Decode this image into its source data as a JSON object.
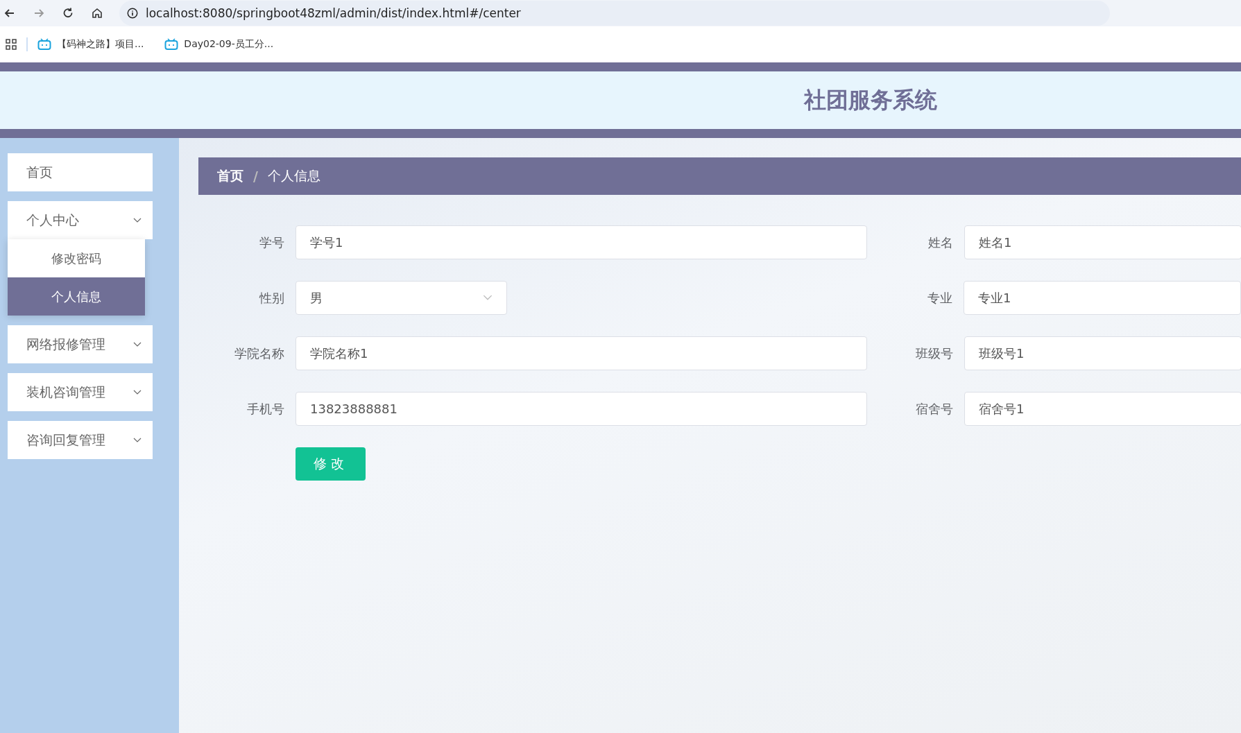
{
  "browser": {
    "url": "localhost:8080/springboot48zml/admin/dist/index.html#/center",
    "bookmarks": [
      "【码神之路】项目...",
      "Day02-09-员工分..."
    ]
  },
  "header": {
    "title": "社团服务系统"
  },
  "sidebar": {
    "items": [
      {
        "label": "首页",
        "kind": "link"
      },
      {
        "label": "个人中心",
        "kind": "submenu",
        "expanded": true,
        "children": [
          {
            "label": "修改密码",
            "selected": false
          },
          {
            "label": "个人信息",
            "selected": true
          }
        ]
      },
      {
        "label": "网络报修管理",
        "kind": "submenu"
      },
      {
        "label": "装机咨询管理",
        "kind": "submenu"
      },
      {
        "label": "咨询回复管理",
        "kind": "submenu"
      }
    ]
  },
  "breadcrumb": {
    "items": [
      "首页",
      "个人信息"
    ],
    "separator": "/"
  },
  "form": {
    "rows": [
      [
        {
          "label": "学号",
          "value": "学号1",
          "kind": "input"
        },
        {
          "label": "姓名",
          "value": "姓名1",
          "kind": "input"
        }
      ],
      [
        {
          "label": "性别",
          "value": "男",
          "kind": "select"
        },
        {
          "label": "专业",
          "value": "专业1",
          "kind": "input"
        }
      ],
      [
        {
          "label": "学院名称",
          "value": "学院名称1",
          "kind": "input"
        },
        {
          "label": "班级号",
          "value": "班级号1",
          "kind": "input"
        }
      ],
      [
        {
          "label": "手机号",
          "value": "13823888881",
          "kind": "input"
        },
        {
          "label": "宿舍号",
          "value": "宿舍号1",
          "kind": "input"
        }
      ]
    ],
    "submit": "修改"
  }
}
